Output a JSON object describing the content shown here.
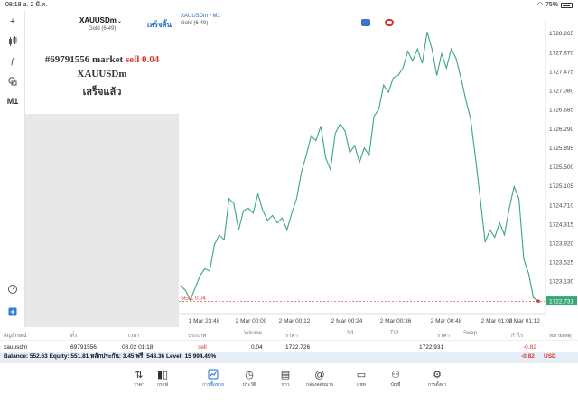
{
  "status": {
    "time": "08:18",
    "date": "อ. 2 มี.ค.",
    "battery": "75%"
  },
  "toolbar": {
    "m1": "M1"
  },
  "order": {
    "symbol": "XAUUSDm",
    "sub": "Gold (6-49)",
    "done_label": "เสร็จสิ้น",
    "ticket_prefix": "#69791556 market ",
    "side_volume": "sell 0.04",
    "line2": "XAUUSDm",
    "line3": "เสร็จแล้ว"
  },
  "chart_header": {
    "title": "XAUUSDm • M1",
    "subtitle": "Gold (6-49)"
  },
  "chart_data": {
    "type": "line",
    "title": "XAUUSDm • M1",
    "x_labels": [
      "1 Mar 23:48",
      "2 Mar 00:00",
      "2 Mar 00:12",
      "2 Mar 00:24",
      "2 Mar 00:36",
      "2 Mar 00:48",
      "2 Mar 01:00",
      "2 Mar 01:12"
    ],
    "y_ticks": [
      "1728.265",
      "1727.870",
      "1727.475",
      "1727.080",
      "1726.685",
      "1726.290",
      "1725.895",
      "1725.500",
      "1725.105",
      "1724.710",
      "1724.315",
      "1723.920",
      "1723.525",
      "1723.130"
    ],
    "ylim": [
      1722.62,
      1728.4
    ],
    "values": [
      1723.05,
      1722.95,
      1722.75,
      1723.0,
      1723.25,
      1723.4,
      1723.35,
      1723.9,
      1724.1,
      1724.0,
      1724.85,
      1724.75,
      1724.2,
      1724.6,
      1724.65,
      1724.55,
      1724.95,
      1724.6,
      1724.4,
      1724.5,
      1724.35,
      1724.45,
      1724.2,
      1724.55,
      1724.85,
      1725.4,
      1725.75,
      1726.15,
      1726.05,
      1726.35,
      1725.7,
      1725.45,
      1726.2,
      1726.4,
      1726.25,
      1725.8,
      1725.95,
      1725.6,
      1725.9,
      1725.75,
      1726.55,
      1726.7,
      1727.2,
      1727.05,
      1727.35,
      1727.4,
      1727.55,
      1727.9,
      1727.7,
      1727.95,
      1727.65,
      1728.3,
      1727.95,
      1727.4,
      1727.85,
      1727.55,
      1727.95,
      1727.75,
      1727.35,
      1726.9,
      1726.5,
      1725.7,
      1724.85,
      1723.95,
      1724.2,
      1724.05,
      1724.35,
      1724.1,
      1724.65,
      1725.1,
      1724.85,
      1723.6,
      1723.3,
      1722.8,
      1722.73
    ],
    "current_price": "1722.731",
    "order_line": {
      "label": "SELL 0.04",
      "price": 1722.726
    }
  },
  "table": {
    "headers": [
      "สัญลักษณ์",
      "ตั๋ว",
      "เวลา",
      "ประเภท",
      "Volume",
      "ราคา",
      "S/L",
      "T/P",
      "ราคา",
      "Swap",
      "กำไร",
      "หมายเหตุ"
    ],
    "row": {
      "symbol": "xauusdm",
      "ticket": "69791556",
      "time": "03.02 01:18",
      "type": "sell",
      "volume": "0.04",
      "price": "1722.726",
      "sl": "",
      "tp": "",
      "price_current": "1722.931",
      "swap": "",
      "profit": "-0.82",
      "comment": ""
    }
  },
  "balance": {
    "text": "Balance: 552.63 Equity: 551.81 หลักประกัน: 3.45 ฟรี: 548.36 Level: 15 994.49%",
    "profit": "-0.82",
    "currency": "USD"
  },
  "tabs": [
    {
      "label": "ราคา",
      "icon": "arrows-updown-icon"
    },
    {
      "label": "กราฟ",
      "icon": "candles-icon"
    },
    {
      "label": "การซื้อขาย",
      "icon": "trend-chart-icon",
      "active": true
    },
    {
      "label": "ประวัติ",
      "icon": "history-clock-icon"
    },
    {
      "label": "ข่าว",
      "icon": "news-book-icon"
    },
    {
      "label": "กล่องจดหมาย",
      "icon": "at-sign-icon"
    },
    {
      "label": "แชท",
      "icon": "chat-bubble-icon"
    },
    {
      "label": "บัญชี",
      "icon": "account-people-icon"
    },
    {
      "label": "การตั้งค่า",
      "icon": "gear-icon"
    }
  ],
  "colors": {
    "line": "#3aa77a",
    "accent": "#1a6dd6",
    "loss": "#d7362d"
  }
}
